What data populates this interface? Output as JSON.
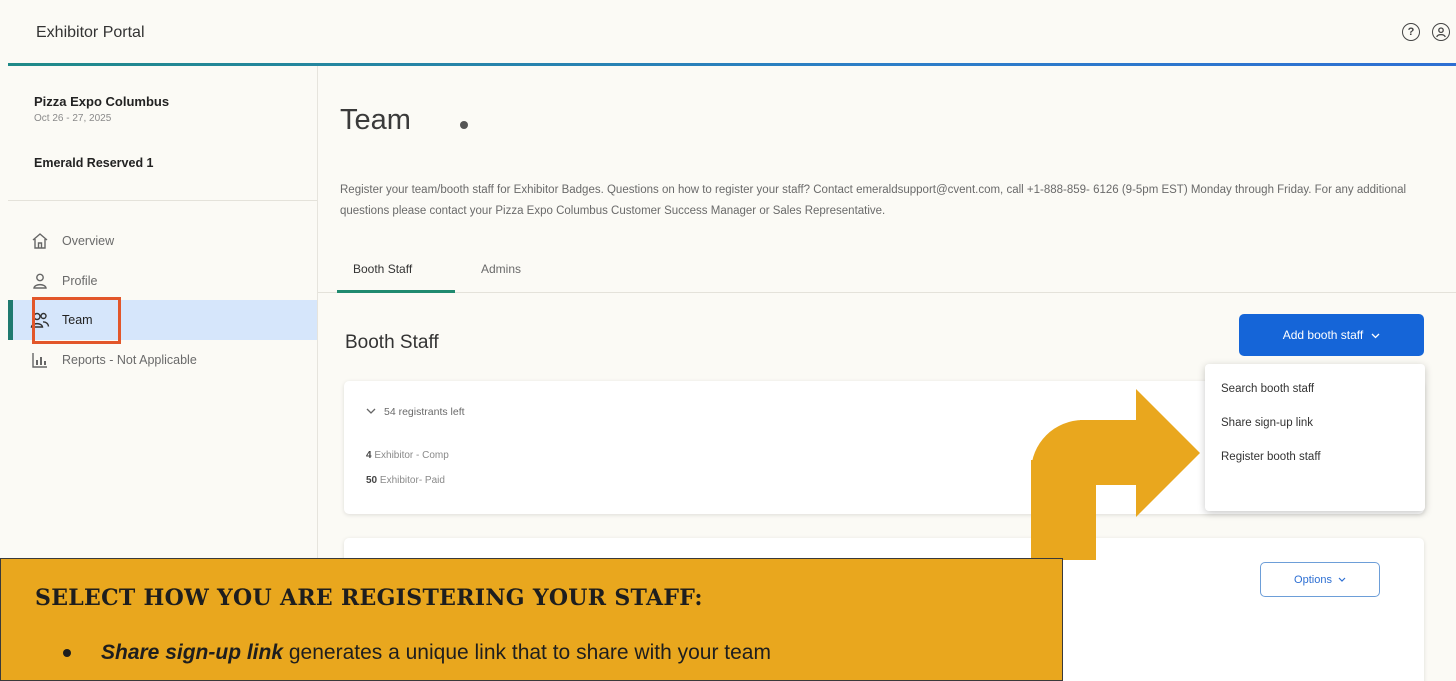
{
  "app": {
    "title": "Exhibitor Portal",
    "help_icon": "help-circle-icon",
    "account_icon": "user-circle-icon"
  },
  "sidebar": {
    "event_name": "Pizza Expo Columbus",
    "event_date": "Oct 26 - 27, 2025",
    "account_name": "Emerald Reserved 1",
    "items": [
      {
        "label": "Overview",
        "icon": "home-icon"
      },
      {
        "label": "Profile",
        "icon": "person-icon"
      },
      {
        "label": "Team",
        "icon": "people-icon",
        "active": true
      },
      {
        "label": "Reports - Not Applicable",
        "icon": "bar-chart-icon"
      }
    ]
  },
  "main": {
    "title": "Team",
    "description": "Register your team/booth staff for Exhibitor Badges. Questions on how to register your staff? Contact emeraldsupport@cvent.com, call +1-888-859- 6126 (9-5pm EST) Monday through Friday. For any additional questions please contact your Pizza Expo Columbus Customer Success Manager or Sales Representative.",
    "tabs": [
      {
        "label": "Booth Staff",
        "active": true
      },
      {
        "label": "Admins",
        "active": false
      }
    ],
    "section_title": "Booth Staff",
    "add_button_label": "Add booth staff",
    "registrants": {
      "summary": "54 registrants left",
      "tickets": [
        {
          "count": "4",
          "label": "Exhibitor - Comp"
        },
        {
          "count": "50",
          "label": "Exhibitor- Paid"
        }
      ]
    },
    "options_button_label": "Options"
  },
  "dropdown": {
    "items": [
      "Search booth staff",
      "Share sign-up link",
      "Register booth staff"
    ]
  },
  "callout": {
    "heading": "SELECT HOW YOU ARE REGISTERING YOUR STAFF:",
    "bullet_emphasis": "Share sign-up link",
    "bullet_text": " generates a unique link that to share with your team"
  },
  "colors": {
    "primary_button": "#1565d8",
    "callout_background": "#e9a71e",
    "highlight_border": "#e2562a",
    "active_nav_background": "#d6e6fb",
    "tab_underline": "#1f8a6f"
  }
}
